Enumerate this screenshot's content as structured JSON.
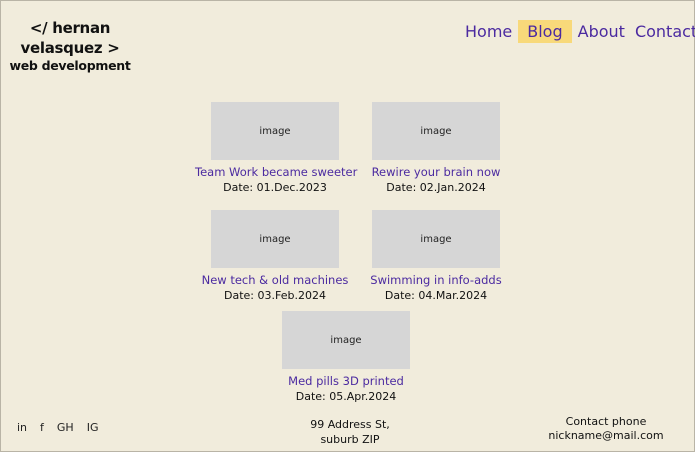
{
  "logo": {
    "line1": "</ hernan",
    "line2": "velasquez >",
    "line3": "web development"
  },
  "nav": {
    "items": [
      {
        "label": "Home",
        "active": false
      },
      {
        "label": "Blog",
        "active": true
      },
      {
        "label": "About",
        "active": false
      },
      {
        "label": "Contact",
        "active": false
      }
    ]
  },
  "posts": [
    {
      "image": "image",
      "title": "Team Work became sweeter",
      "date": "Date: 01.Dec.2023"
    },
    {
      "image": "image",
      "title": "Rewire your brain now",
      "date": "Date: 02.Jan.2024"
    },
    {
      "image": "image",
      "title": "New tech & old machines",
      "date": "Date: 03.Feb.2024"
    },
    {
      "image": "image",
      "title": "Swimming in info-adds",
      "date": "Date: 04.Mar.2024"
    },
    {
      "image": "image",
      "title": "Med pills 3D printed",
      "date": "Date: 05.Apr.2024"
    }
  ],
  "footer": {
    "social": [
      "in",
      "f",
      "GH",
      "IG"
    ],
    "address_line1": "99 Address St,",
    "address_line2": "suburb ZIP",
    "contact_line1": "Contact phone",
    "contact_line2": "nickname@mail.com"
  },
  "colors": {
    "background": "#f1ecdc",
    "link": "#4b2aa0",
    "active_tab": "#f8d97a",
    "placeholder": "#d6d6d6"
  }
}
